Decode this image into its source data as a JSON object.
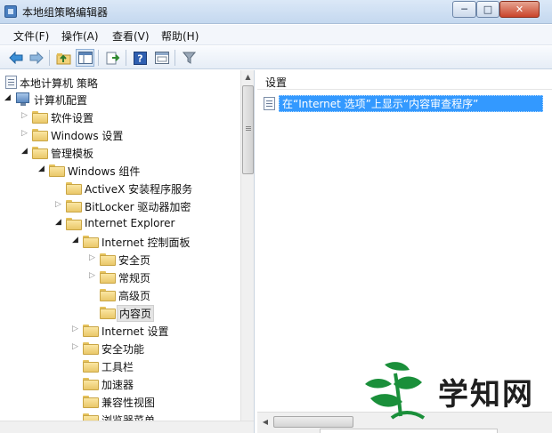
{
  "window": {
    "title": "本地组策略编辑器",
    "controls": {
      "minimize": "─",
      "maximize": "□",
      "close": "✕"
    }
  },
  "menu": [
    {
      "label": "文件(F)"
    },
    {
      "label": "操作(A)"
    },
    {
      "label": "查看(V)"
    },
    {
      "label": "帮助(H)"
    }
  ],
  "toolbar": {
    "buttons": [
      "back-arrow-icon",
      "forward-arrow-icon",
      "up-folder-icon",
      "show-hide-tree-icon",
      "export-list-icon",
      "help-icon",
      "properties-icon",
      "filter-icon"
    ]
  },
  "tree": {
    "root": "本地计算机 策略",
    "items": [
      {
        "label": "计算机配置"
      },
      {
        "label": "软件设置"
      },
      {
        "label": "Windows 设置"
      },
      {
        "label": "管理模板"
      },
      {
        "label": "Windows 组件"
      },
      {
        "label": "ActiveX 安装程序服务"
      },
      {
        "label": "BitLocker 驱动器加密"
      },
      {
        "label": "Internet Explorer"
      },
      {
        "label": "Internet 控制面板"
      },
      {
        "label": "安全页"
      },
      {
        "label": "常规页"
      },
      {
        "label": "高级页"
      },
      {
        "label": "内容页"
      },
      {
        "label": "Internet 设置"
      },
      {
        "label": "安全功能"
      },
      {
        "label": "工具栏"
      },
      {
        "label": "加速器"
      },
      {
        "label": "兼容性视图"
      },
      {
        "label": "浏览器菜单"
      }
    ]
  },
  "settings": {
    "header": "设置",
    "rows": [
      {
        "text": "在“Internet 选项”上显示“内容审查程序”"
      }
    ]
  },
  "watermark": {
    "text": "学知网",
    "leaf_color": "#1a8f3a"
  },
  "colors": {
    "selection": "#3399ff"
  }
}
